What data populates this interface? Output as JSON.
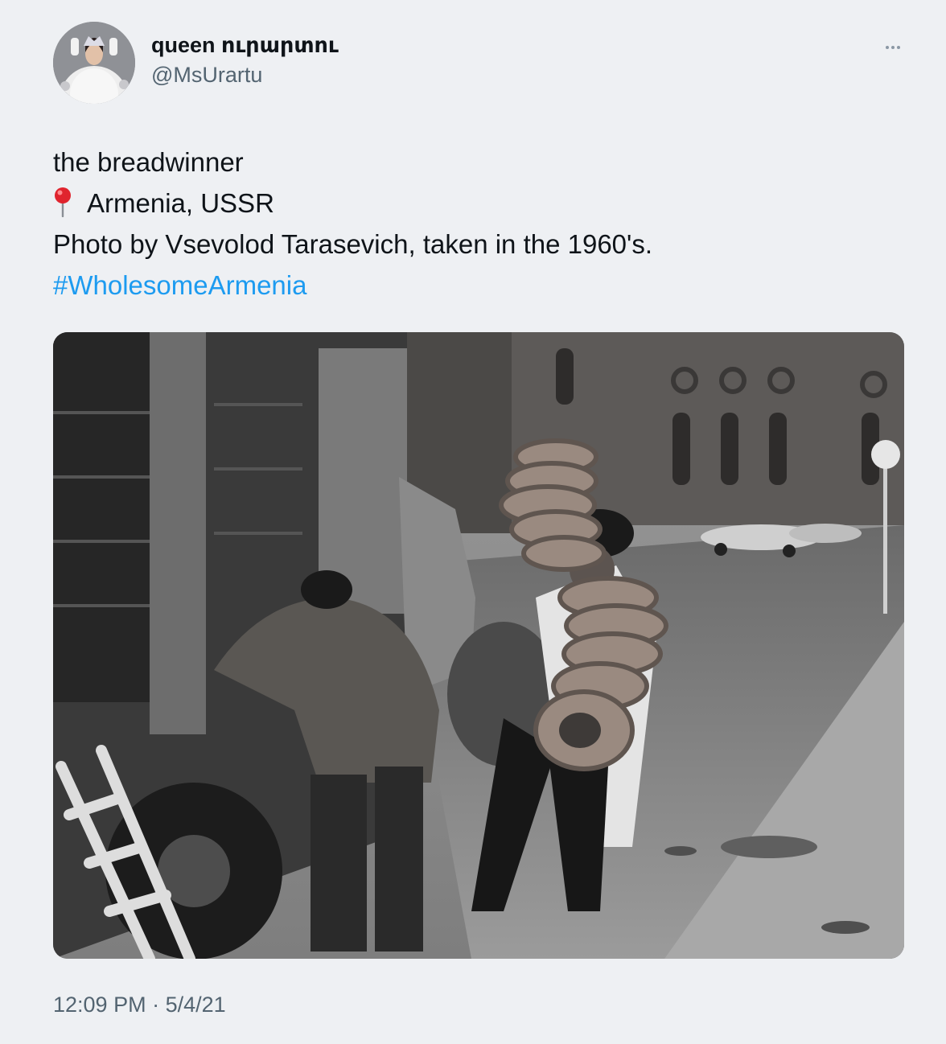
{
  "author": {
    "display_name": "queen ուրարտու",
    "handle": "@MsUrartu"
  },
  "tweet": {
    "lines": [
      "the breadwinner",
      "Armenia, USSR",
      "Photo by Vsevolod Tarasevich, taken in the 1960's."
    ],
    "pin_icon": "round-pushpin-icon",
    "hashtag": "#WholesomeArmenia",
    "time": "12:09 PM",
    "separator": "·",
    "date": "5/4/21"
  },
  "colors": {
    "background": "#eef0f3",
    "text": "#0f1419",
    "secondary": "#536471",
    "link": "#1d9bf0"
  },
  "icons": {
    "more": "more-horizontal-icon"
  }
}
